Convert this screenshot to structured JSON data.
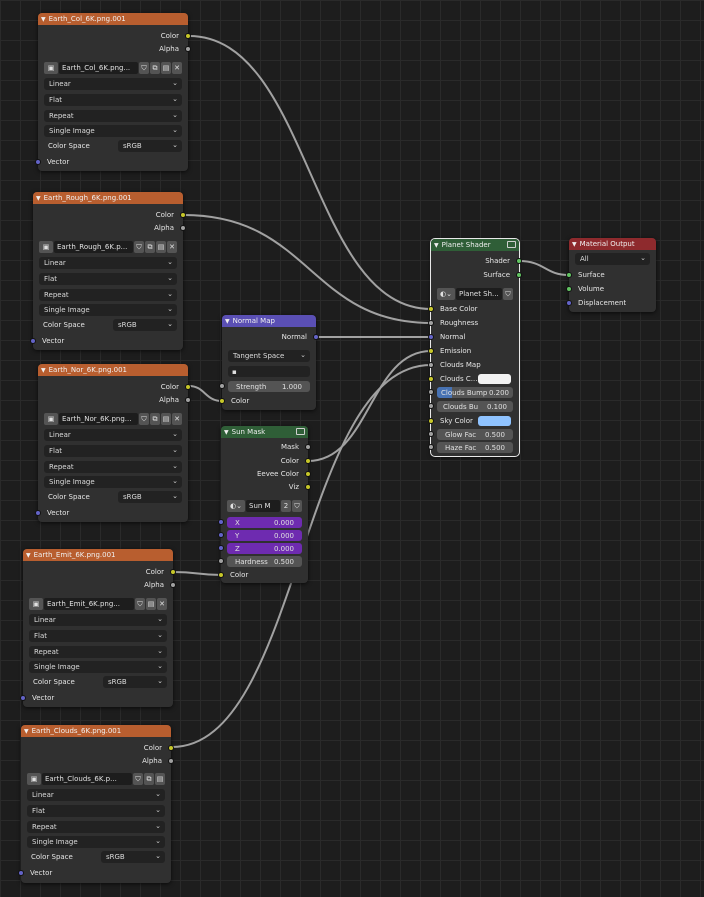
{
  "common": {
    "interp": "Linear",
    "proj": "Flat",
    "ext": "Repeat",
    "src": "Single Image",
    "cs_label": "Color Space",
    "cs_value": "sRGB",
    "out_color": "Color",
    "out_alpha": "Alpha",
    "in_vector": "Vector",
    "close": "✕"
  },
  "tex_col": {
    "title": "Earth_Col_6K.png.001",
    "image": "Earth_Col_6K.png..."
  },
  "tex_rough": {
    "title": "Earth_Rough_6K.png.001",
    "image": "Earth_Rough_6K.p..."
  },
  "tex_nor": {
    "title": "Earth_Nor_6K.png.001",
    "image": "Earth_Nor_6K.png..."
  },
  "tex_emit": {
    "title": "Earth_Emit_6K.png.001",
    "image": "Earth_Emit_6K.png..."
  },
  "tex_clouds": {
    "title": "Earth_Clouds_6K.png.001",
    "image": "Earth_Clouds_6K.p..."
  },
  "normal_map": {
    "title": "Normal Map",
    "out_normal": "Normal",
    "space": "Tangent Space",
    "strength_label": "Strength",
    "strength_value": "1.000",
    "in_color": "Color"
  },
  "sun_mask": {
    "title": "Sun Mask",
    "outputs": [
      "Mask",
      "Color",
      "Eevee Color",
      "Viz"
    ],
    "group_name": "Sun M",
    "users": "2",
    "x_label": "X",
    "x_value": "0.000",
    "y_label": "Y",
    "y_value": "0.000",
    "z_label": "Z",
    "z_value": "0.000",
    "hardness_label": "Hardness",
    "hardness_value": "0.500",
    "in_color": "Color"
  },
  "planet_shader": {
    "title": "Planet Shader",
    "out_shader": "Shader",
    "out_surface": "Surface",
    "group_name": "Planet Sh...",
    "inputs": [
      "Base Color",
      "Roughness",
      "Normal",
      "Emission",
      "Clouds Map"
    ],
    "clouds_c_label": "Clouds C...",
    "clouds_bump_label": "Clouds Bump",
    "clouds_bump_value": "0.200",
    "clouds_bu_label": "Clouds Bu",
    "clouds_bu_value": "0.100",
    "sky_color_label": "Sky Color",
    "glow_label": "Glow Fac",
    "glow_value": "0.500",
    "haze_label": "Haze Fac",
    "haze_value": "0.500"
  },
  "material_output": {
    "title": "Material Output",
    "target": "All",
    "inputs": [
      "Surface",
      "Volume",
      "Displacement"
    ]
  },
  "colors": {
    "header_texture": "#b85e2f",
    "header_vector": "#5a4fb4",
    "header_group": "#2f5e37",
    "header_output": "#8e2a2d",
    "socket_color": "#c7c729",
    "socket_float": "#a1a1a1",
    "socket_vector": "#6363c7",
    "socket_shader": "#62c462",
    "sky_color": "#8fc3ff",
    "clouds_color": "#f2f2f2"
  }
}
